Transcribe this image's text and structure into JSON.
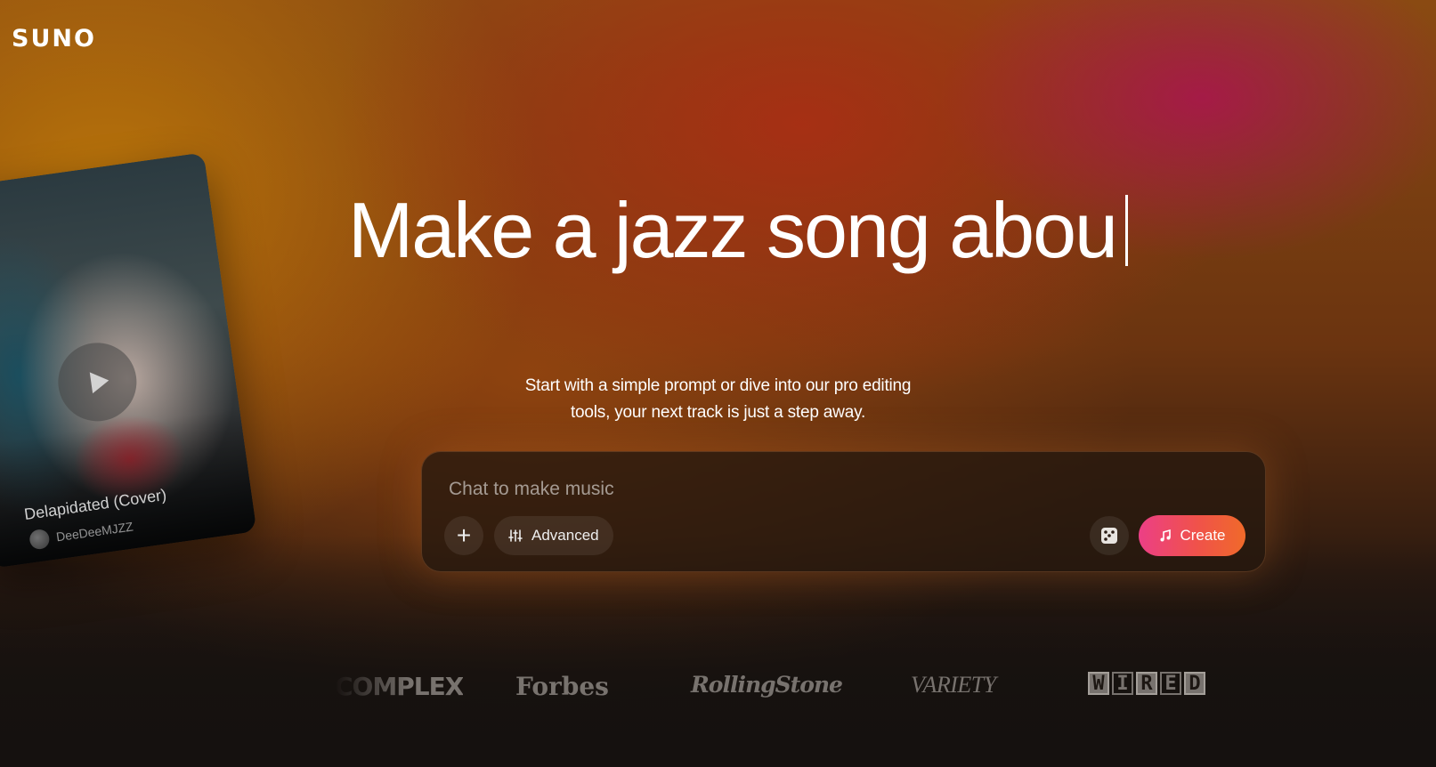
{
  "brand": {
    "logo_text": "SUNO"
  },
  "hero": {
    "headline": "Make a jazz song abou",
    "subtitle_line1": "Start with a simple prompt or dive into our pro editing",
    "subtitle_line2": "tools, your next track is just a step away."
  },
  "featured_song": {
    "title": "Delapidated (Cover)",
    "artist": "DeeDeeMJZZ",
    "play_icon": "play-icon"
  },
  "composer": {
    "placeholder": "Chat to make music",
    "value": "",
    "add_icon": "plus-icon",
    "advanced_label": "Advanced",
    "advanced_icon": "sliders-icon",
    "dice_icon": "dice-icon",
    "create_label": "Create",
    "create_icon": "music-note-icon"
  },
  "press_logos": {
    "complex": "COMPLEX",
    "forbes": "Forbes",
    "rollingstone": "RollingStone",
    "variety": "VARIETY",
    "wired": [
      "W",
      "I",
      "R",
      "E",
      "D"
    ]
  },
  "colors": {
    "create_gradient_start": "#ec3f86",
    "create_gradient_end": "#f06a2a",
    "background_warm": "#8a4a12",
    "background_magenta": "#aa1450",
    "background_dark": "#15110f"
  }
}
